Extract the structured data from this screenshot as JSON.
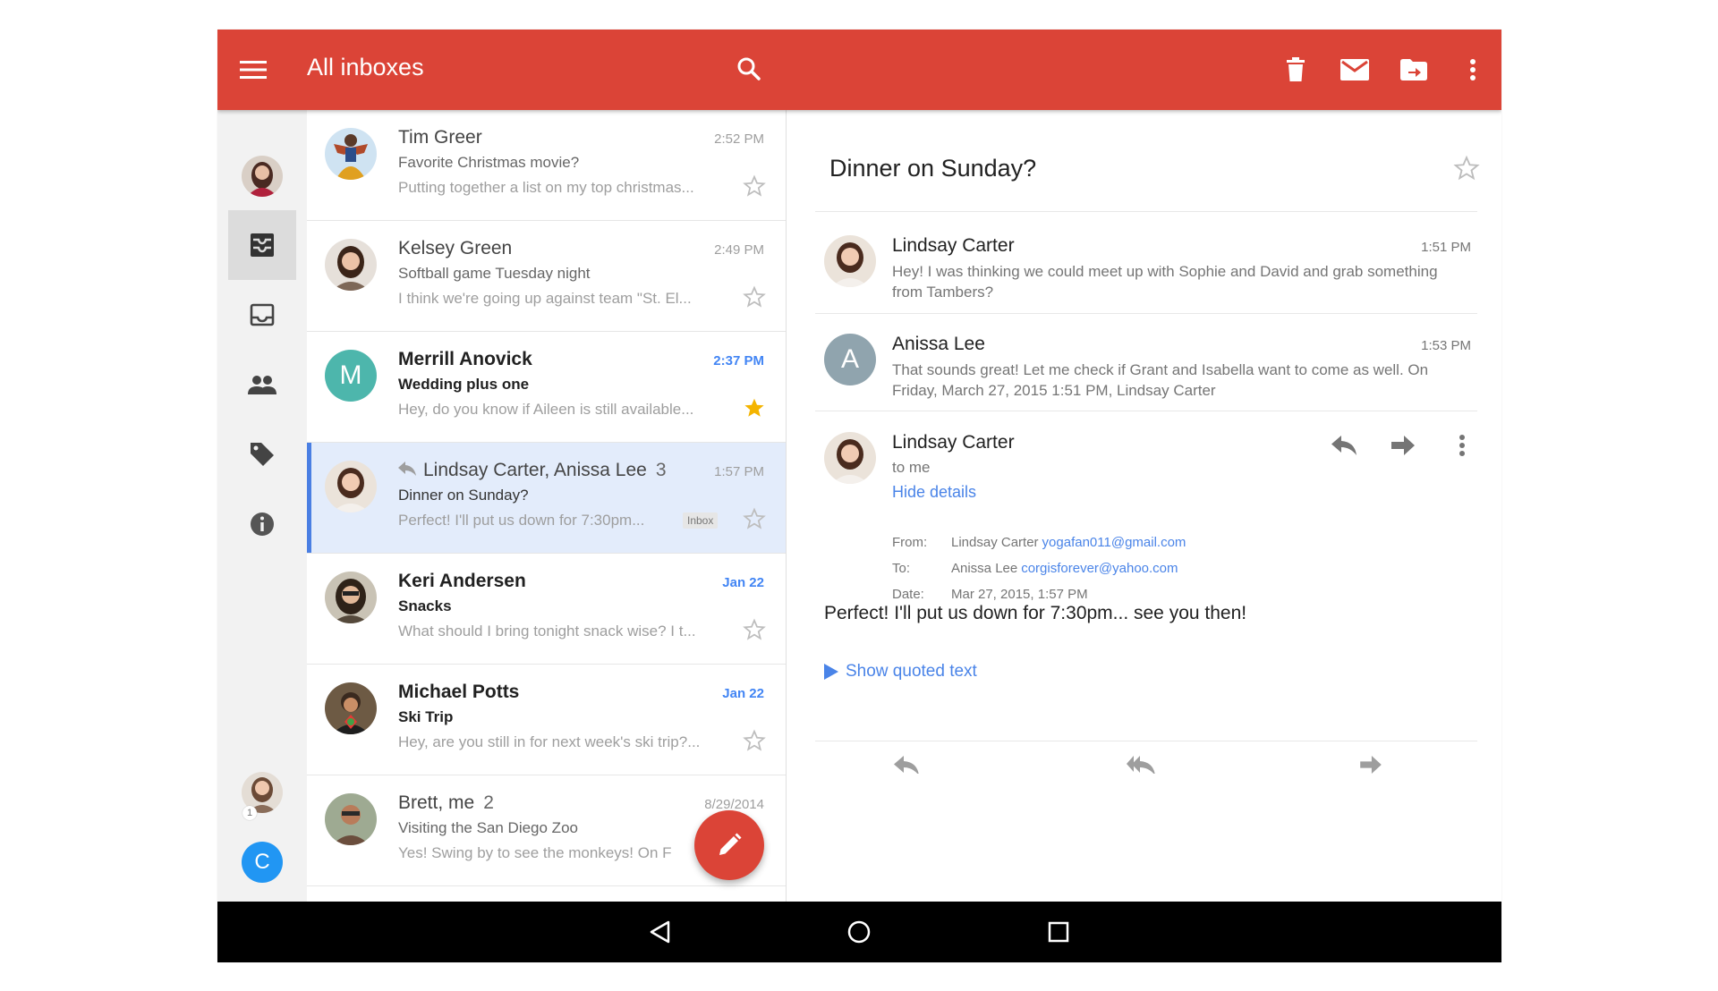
{
  "appbar": {
    "title": "All inboxes",
    "icons": [
      "menu-icon",
      "search-icon",
      "delete-icon",
      "mark-unread-icon",
      "move-to-icon",
      "more-vert-icon"
    ],
    "color": "#db4437"
  },
  "rail": {
    "icons": [
      "account-avatar",
      "all-inboxes-icon",
      "inbox-icon",
      "social-icon",
      "labels-icon",
      "info-icon",
      "account-avatar-2",
      "account-avatar-c"
    ],
    "account_c_letter": "C",
    "account_badge": "1"
  },
  "emails": [
    {
      "sender": "Tim Greer",
      "count": "",
      "subject": "Favorite Christmas movie?",
      "snippet": "Putting together a list on my top christmas...",
      "time": "2:52 PM",
      "unread": false,
      "starred": false
    },
    {
      "sender": "Kelsey Green",
      "count": "",
      "subject": "Softball game Tuesday night",
      "snippet": "I think we're going up against team \"St. El...",
      "time": "2:49 PM",
      "unread": false,
      "starred": false
    },
    {
      "sender": "Merrill Anovick",
      "count": "",
      "subject": "Wedding plus one",
      "snippet": "Hey, do you know if Aileen is still available...",
      "time": "2:37 PM",
      "unread": true,
      "starred": true,
      "avatar_letter": "M"
    },
    {
      "sender": "Lindsay Carter, Anissa Lee",
      "count": "3",
      "subject": "Dinner on Sunday?",
      "snippet": "Perfect! I'll put us down for 7:30pm...",
      "time": "1:57 PM",
      "unread": false,
      "starred": false,
      "badge": "Inbox",
      "selected": true
    },
    {
      "sender": "Keri Andersen",
      "count": "",
      "subject": "Snacks",
      "snippet": "What should I bring tonight snack wise? I t...",
      "time": "Jan 22",
      "unread": true,
      "starred": false
    },
    {
      "sender": "Michael Potts",
      "count": "",
      "subject": "Ski Trip",
      "snippet": "Hey, are you still in for next week's ski trip?...",
      "time": "Jan 22",
      "unread": true,
      "starred": false
    },
    {
      "sender": "Brett, me",
      "count": "2",
      "subject": "Visiting the San Diego Zoo",
      "snippet": "Yes! Swing by to see the monkeys! On F",
      "time": "8/29/2014",
      "unread": false,
      "starred": false
    }
  ],
  "thread": {
    "subject": "Dinner on Sunday?",
    "messages": [
      {
        "sender": "Lindsay Carter",
        "time": "1:51 PM",
        "body": "Hey! I was thinking we could meet up with Sophie and David and grab something from Tambers?"
      },
      {
        "sender": "Anissa Lee",
        "time": "1:53 PM",
        "body": "That sounds great! Let me check if Grant and Isabella want to come as well. On Friday, March 27, 2015 1:51 PM, Lindsay Carter",
        "avatar_letter": "A"
      }
    ],
    "expanded": {
      "sender": "Lindsay Carter",
      "to_line": "to me",
      "hide_details": "Hide details",
      "from_label": "From:",
      "from_name": "Lindsay Carter",
      "from_email": "yogafan011@gmail.com",
      "to_label": "To:",
      "to_name": "Anissa Lee",
      "to_email": "corgisforever@yahoo.com",
      "date_label": "Date:",
      "date_value": "Mar 27, 2015, 1:57 PM",
      "body": "Perfect! I'll put us down for 7:30pm... see you then!",
      "show_quoted": "Show quoted text"
    }
  },
  "navbar": {
    "icons": [
      "back-icon",
      "home-icon",
      "recents-icon"
    ]
  },
  "colors": {
    "accent": "#db4437",
    "link": "#4a84e8",
    "selected_row": "#e3ecfb",
    "unread_time": "#4285f4",
    "star": "#f4b400",
    "teal_avatar": "#4db6ac",
    "blue_avatar": "#2196f3",
    "grey_avatar": "#90a4ae"
  }
}
